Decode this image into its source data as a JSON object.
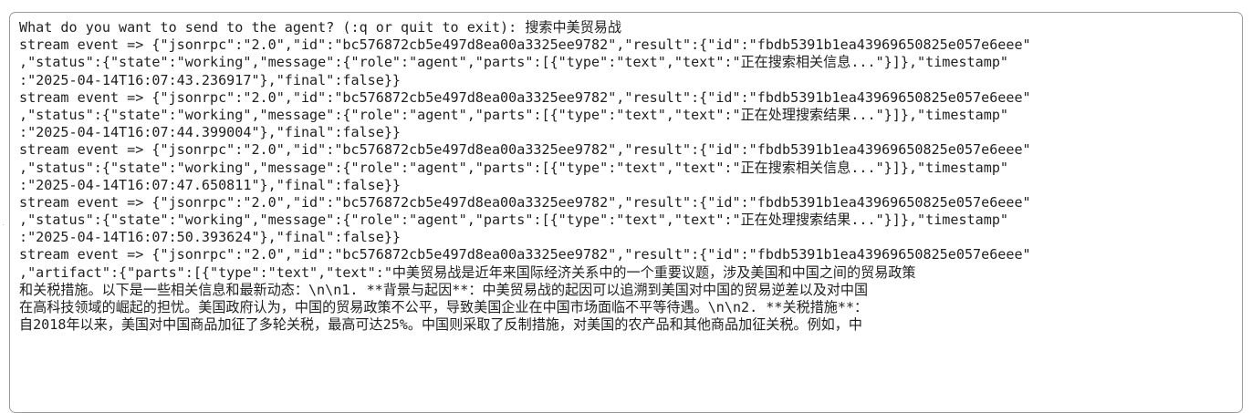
{
  "terminal": {
    "lines": [
      "What do you want to send to the agent? (:q or quit to exit): 搜索中美贸易战",
      "stream event => {\"jsonrpc\":\"2.0\",\"id\":\"bc576872cb5e497d8ea00a3325ee9782\",\"result\":{\"id\":\"fbdb5391b1ea43969650825e057e6eee\"",
      ",\"status\":{\"state\":\"working\",\"message\":{\"role\":\"agent\",\"parts\":[{\"type\":\"text\",\"text\":\"正在搜索相关信息...\"}]},\"timestamp\"",
      ":\"2025-04-14T16:07:43.236917\"},\"final\":false}}",
      "stream event => {\"jsonrpc\":\"2.0\",\"id\":\"bc576872cb5e497d8ea00a3325ee9782\",\"result\":{\"id\":\"fbdb5391b1ea43969650825e057e6eee\"",
      ",\"status\":{\"state\":\"working\",\"message\":{\"role\":\"agent\",\"parts\":[{\"type\":\"text\",\"text\":\"正在处理搜索结果...\"}]},\"timestamp\"",
      ":\"2025-04-14T16:07:44.399004\"},\"final\":false}}",
      "stream event => {\"jsonrpc\":\"2.0\",\"id\":\"bc576872cb5e497d8ea00a3325ee9782\",\"result\":{\"id\":\"fbdb5391b1ea43969650825e057e6eee\"",
      ",\"status\":{\"state\":\"working\",\"message\":{\"role\":\"agent\",\"parts\":[{\"type\":\"text\",\"text\":\"正在搜索相关信息...\"}]},\"timestamp\"",
      ":\"2025-04-14T16:07:47.650811\"},\"final\":false}}",
      "stream event => {\"jsonrpc\":\"2.0\",\"id\":\"bc576872cb5e497d8ea00a3325ee9782\",\"result\":{\"id\":\"fbdb5391b1ea43969650825e057e6eee\"",
      ",\"status\":{\"state\":\"working\",\"message\":{\"role\":\"agent\",\"parts\":[{\"type\":\"text\",\"text\":\"正在处理搜索结果...\"}]},\"timestamp\"",
      ":\"2025-04-14T16:07:50.393624\"},\"final\":false}}",
      "stream event => {\"jsonrpc\":\"2.0\",\"id\":\"bc576872cb5e497d8ea00a3325ee9782\",\"result\":{\"id\":\"fbdb5391b1ea43969650825e057e6eee\"",
      ",\"artifact\":{\"parts\":[{\"type\":\"text\",\"text\":\"中美贸易战是近年来国际经济关系中的一个重要议题，涉及美国和中国之间的贸易政策",
      "和关税措施。以下是一些相关信息和最新动态：\\n\\n1. **背景与起因**：中美贸易战的起因可以追溯到美国对中国的贸易逆差以及对中国",
      "在高科技领域的崛起的担忧。美国政府认为，中国的贸易政策不公平，导致美国企业在中国市场面临不平等待遇。\\n\\n2. **关税措施**：",
      "自2018年以来，美国对中国商品加征了多轮关税，最高可达25%。中国则采取了反制措施，对美国的农产品和其他商品加征关税。例如，中"
    ]
  }
}
